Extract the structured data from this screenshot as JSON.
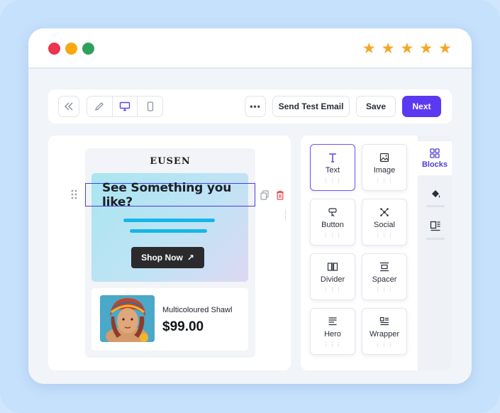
{
  "window": {
    "rating_stars": 5
  },
  "toolbar": {
    "collapse_icon": "double-chevron-left-icon",
    "view_modes": [
      "edit",
      "desktop",
      "mobile"
    ],
    "active_view": "desktop",
    "more_icon": "more-horizontal-icon",
    "more_label": "•••",
    "send_test_label": "Send Test Email",
    "save_label": "Save",
    "next_label": "Next"
  },
  "email": {
    "logo": "EUSEN",
    "headline": "See Something you like?",
    "cta_label": "Shop Now",
    "cta_icon": "↗",
    "product": {
      "name": "Multicoloured Shawl",
      "price": "$99.00"
    }
  },
  "blocks": [
    {
      "label": "Text",
      "icon": "text-icon"
    },
    {
      "label": "Image",
      "icon": "image-icon"
    },
    {
      "label": "Button",
      "icon": "button-icon"
    },
    {
      "label": "Social",
      "icon": "social-icon"
    },
    {
      "label": "Divider",
      "icon": "divider-icon"
    },
    {
      "label": "Spacer",
      "icon": "spacer-icon"
    },
    {
      "label": "Hero",
      "icon": "hero-icon"
    },
    {
      "label": "Wrapper",
      "icon": "wrapper-icon"
    }
  ],
  "rail": {
    "blocks_label": "Blocks"
  },
  "colors": {
    "accent": "#5b39f1",
    "selection": "#4a3be6",
    "hero_line": "#15b6e8",
    "star": "#f6a623"
  }
}
